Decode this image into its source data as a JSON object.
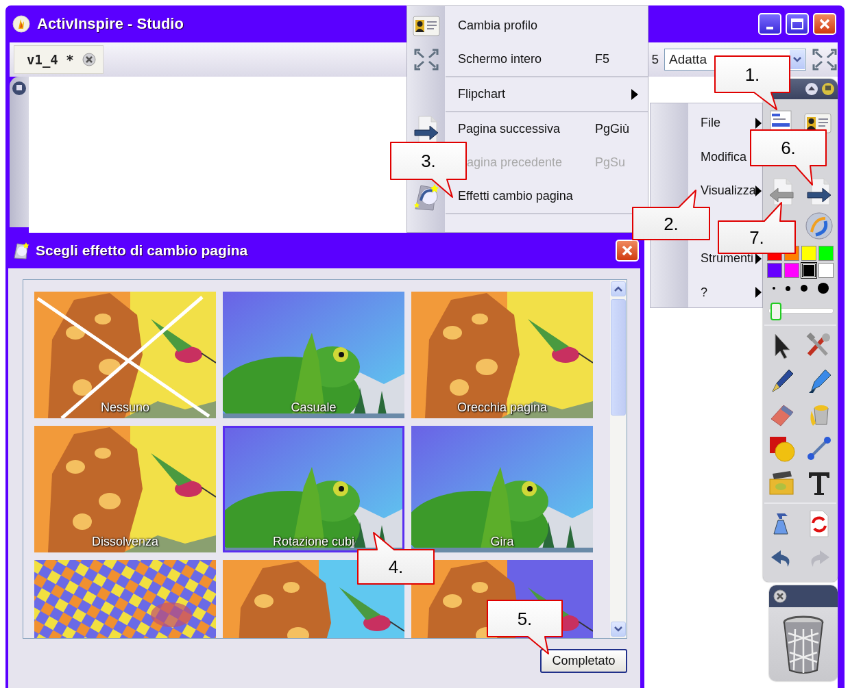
{
  "window": {
    "title": "ActivInspire - Studio"
  },
  "tab": {
    "label": "v1_4 *"
  },
  "toolbar": {
    "partial_text": "5",
    "zoom_field": "Adatta"
  },
  "menu": {
    "items": [
      {
        "kind": "item",
        "label": "Cambia profilo",
        "disabled": false
      },
      {
        "kind": "item",
        "label": "Schermo intero",
        "shortcut": "F5",
        "disabled": false
      },
      {
        "kind": "separator"
      },
      {
        "kind": "submenu",
        "label": "Flipchart",
        "disabled": false
      },
      {
        "kind": "separator"
      },
      {
        "kind": "item",
        "label": "Pagina successiva",
        "shortcut": "PgGiù",
        "disabled": false
      },
      {
        "kind": "item",
        "label": "agina precedente",
        "shortcut": "PgSu",
        "disabled": true
      },
      {
        "kind": "item",
        "label": "Effetti cambio pagina",
        "disabled": false
      },
      {
        "kind": "separator"
      }
    ]
  },
  "submenu": {
    "items": [
      {
        "kind": "submenu",
        "label": "File"
      },
      {
        "kind": "item",
        "label": "Modifica"
      },
      {
        "kind": "submenu",
        "label": "Visualizza"
      },
      {
        "kind": "submenu",
        "label": "Strumenti"
      },
      {
        "kind": "submenu",
        "label": "?"
      }
    ]
  },
  "toolbox": {
    "palette": [
      {
        "color": "#ff0000",
        "selected": false
      },
      {
        "color": "#ff8000",
        "selected": false
      },
      {
        "color": "#ffff00",
        "selected": false
      },
      {
        "color": "#00ff00",
        "selected": false
      },
      {
        "color": "#6600ff",
        "selected": false
      },
      {
        "color": "#ff00ff",
        "selected": false
      },
      {
        "color": "#000000",
        "selected": true
      },
      {
        "color": "#ffffff",
        "selected": false
      }
    ],
    "width_slider": {
      "level": 0.05
    }
  },
  "dialog": {
    "title": "Scegli effetto di cambio pagina",
    "effects": [
      {
        "label": "Nessuno",
        "selected": false
      },
      {
        "label": "Casuale",
        "selected": false
      },
      {
        "label": "Orecchia pagina",
        "selected": false
      },
      {
        "label": "Dissolvenza",
        "selected": false
      },
      {
        "label": "Rotazione cubi",
        "selected": true
      },
      {
        "label": "Gira",
        "selected": false
      },
      {
        "selected": false
      },
      {
        "selected": false
      },
      {
        "selected": false
      }
    ],
    "button": "Completato"
  },
  "callouts": [
    {
      "label": "1."
    },
    {
      "label": "2."
    },
    {
      "label": "3."
    },
    {
      "label": "4."
    },
    {
      "label": "5."
    },
    {
      "label": "6."
    },
    {
      "label": "7."
    }
  ]
}
